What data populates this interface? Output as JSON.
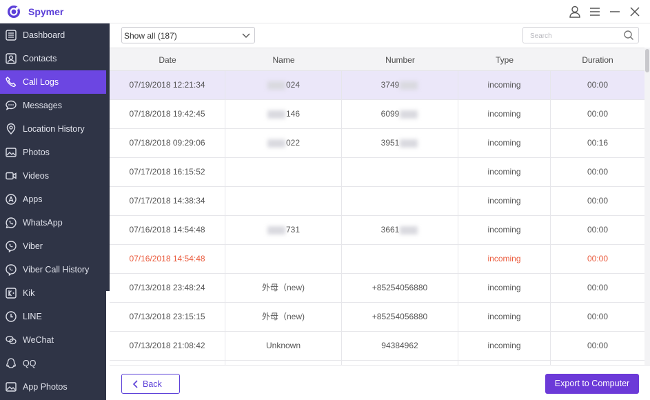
{
  "app": {
    "name": "Spymer",
    "accent": "#6c46e2"
  },
  "titlebar": {
    "icons": [
      "user-icon",
      "menu-icon",
      "minimize-icon",
      "close-icon"
    ]
  },
  "sidebar": {
    "items": [
      {
        "label": "Dashboard",
        "icon": "dashboard-icon"
      },
      {
        "label": "Contacts",
        "icon": "contacts-icon"
      },
      {
        "label": "Call Logs",
        "icon": "phone-icon",
        "active": true
      },
      {
        "label": "Messages",
        "icon": "chat-bubble-icon"
      },
      {
        "label": "Location History",
        "icon": "location-pin-icon"
      },
      {
        "label": "Photos",
        "icon": "photo-icon"
      },
      {
        "label": "Videos",
        "icon": "video-camera-icon"
      },
      {
        "label": "Apps",
        "icon": "apps-icon"
      },
      {
        "label": "WhatsApp",
        "icon": "whatsapp-icon"
      },
      {
        "label": "Viber",
        "icon": "viber-icon"
      },
      {
        "label": "Viber Call History",
        "icon": "viber-call-icon"
      },
      {
        "label": "Kik",
        "icon": "kik-icon"
      },
      {
        "label": "LINE",
        "icon": "line-icon"
      },
      {
        "label": "WeChat",
        "icon": "wechat-icon"
      },
      {
        "label": "QQ",
        "icon": "qq-icon"
      },
      {
        "label": "App Photos",
        "icon": "app-photos-icon"
      }
    ]
  },
  "filter": {
    "selected": "Show all (187)"
  },
  "search": {
    "placeholder": "Search"
  },
  "table": {
    "headers": [
      "Date",
      "Name",
      "Number",
      "Type",
      "Duration"
    ],
    "rows": [
      {
        "date": "07/19/2018 12:21:34",
        "name": "024",
        "number": "3749",
        "type": "incoming",
        "duration": "00:00",
        "selected": true
      },
      {
        "date": "07/18/2018 19:42:45",
        "name": "146",
        "number": "6099",
        "type": "incoming",
        "duration": "00:00"
      },
      {
        "date": "07/18/2018 09:29:06",
        "name": "022",
        "number": "3951",
        "type": "incoming",
        "duration": "00:16"
      },
      {
        "date": "07/17/2018 16:15:52",
        "name": "",
        "number": "",
        "type": "incoming",
        "duration": "00:00"
      },
      {
        "date": "07/17/2018 14:38:34",
        "name": "",
        "number": "",
        "type": "incoming",
        "duration": "00:00"
      },
      {
        "date": "07/16/2018 14:54:48",
        "name": "731",
        "number": "3661",
        "type": "incoming",
        "duration": "00:00"
      },
      {
        "date": "07/16/2018 14:54:48",
        "name": "",
        "number": "",
        "type": "incoming",
        "duration": "00:00",
        "highlight": true
      },
      {
        "date": "07/13/2018 23:48:24",
        "name": "外母（new)",
        "number": "+85254056880",
        "type": "incoming",
        "duration": "00:00"
      },
      {
        "date": "07/13/2018 23:15:15",
        "name": "外母（new)",
        "number": "+85254056880",
        "type": "incoming",
        "duration": "00:00"
      },
      {
        "date": "07/13/2018 21:08:42",
        "name": "Unknown",
        "number": "94384962",
        "type": "incoming",
        "duration": "00:00"
      },
      {
        "date": "",
        "name": "",
        "number": "",
        "type": "",
        "duration": ""
      }
    ]
  },
  "footer": {
    "back_label": "Back",
    "export_label": "Export to Computer"
  }
}
